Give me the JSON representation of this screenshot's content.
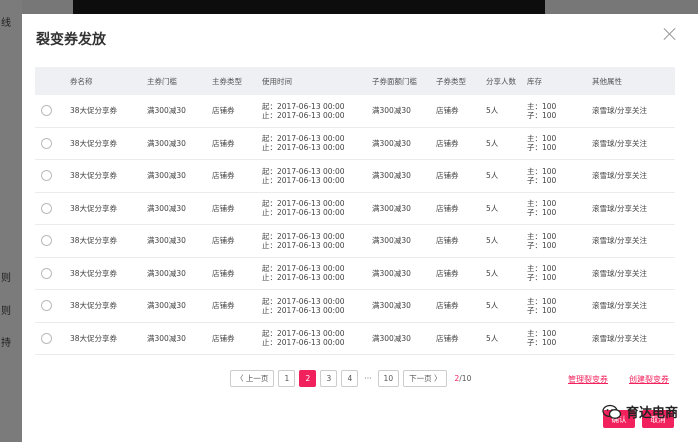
{
  "background": {
    "side_chars": [
      "线",
      "则",
      "则",
      "持"
    ]
  },
  "modal": {
    "title": "裂变券发放"
  },
  "table": {
    "headers": [
      "券名称",
      "主券门槛",
      "主券类型",
      "使用时间",
      "子券面额门槛",
      "子券类型",
      "分享人数",
      "库存",
      "其他属性"
    ],
    "rows": [
      {
        "name": "38大促分享券",
        "threshold": "满300减30",
        "type": "店铺券",
        "start": "起：2017-06-13 00:00",
        "end": "止：2017-06-13 00:00",
        "sub_threshold": "满300减30",
        "sub_type": "店铺券",
        "share": "5人",
        "stock_main": "主：100",
        "stock_sub": "子：100",
        "attr": "滚雪球/分享关注"
      },
      {
        "name": "38大促分享券",
        "threshold": "满300减30",
        "type": "店铺券",
        "start": "起：2017-06-13 00:00",
        "end": "止：2017-06-13 00:00",
        "sub_threshold": "满300减30",
        "sub_type": "店铺券",
        "share": "5人",
        "stock_main": "主：100",
        "stock_sub": "子：100",
        "attr": "滚雪球/分享关注"
      },
      {
        "name": "38大促分享券",
        "threshold": "满300减30",
        "type": "店铺券",
        "start": "起：2017-06-13 00:00",
        "end": "止：2017-06-13 00:00",
        "sub_threshold": "满300减30",
        "sub_type": "店铺券",
        "share": "5人",
        "stock_main": "主：100",
        "stock_sub": "子：100",
        "attr": "滚雪球/分享关注"
      },
      {
        "name": "38大促分享券",
        "threshold": "满300减30",
        "type": "店铺券",
        "start": "起：2017-06-13 00:00",
        "end": "止：2017-06-13 00:00",
        "sub_threshold": "满300减30",
        "sub_type": "店铺券",
        "share": "5人",
        "stock_main": "主：100",
        "stock_sub": "子：100",
        "attr": "滚雪球/分享关注"
      },
      {
        "name": "38大促分享券",
        "threshold": "满300减30",
        "type": "店铺券",
        "start": "起：2017-06-13 00:00",
        "end": "止：2017-06-13 00:00",
        "sub_threshold": "满300减30",
        "sub_type": "店铺券",
        "share": "5人",
        "stock_main": "主：100",
        "stock_sub": "子：100",
        "attr": "滚雪球/分享关注"
      },
      {
        "name": "38大促分享券",
        "threshold": "满300减30",
        "type": "店铺券",
        "start": "起：2017-06-13 00:00",
        "end": "止：2017-06-13 00:00",
        "sub_threshold": "满300减30",
        "sub_type": "店铺券",
        "share": "5人",
        "stock_main": "主：100",
        "stock_sub": "子：100",
        "attr": "滚雪球/分享关注"
      },
      {
        "name": "38大促分享券",
        "threshold": "满300减30",
        "type": "店铺券",
        "start": "起：2017-06-13 00:00",
        "end": "止：2017-06-13 00:00",
        "sub_threshold": "满300减30",
        "sub_type": "店铺券",
        "share": "5人",
        "stock_main": "主：100",
        "stock_sub": "子：100",
        "attr": "滚雪球/分享关注"
      },
      {
        "name": "38大促分享券",
        "threshold": "满300减30",
        "type": "店铺券",
        "start": "起：2017-06-13 00:00",
        "end": "止：2017-06-13 00:00",
        "sub_threshold": "满300减30",
        "sub_type": "店铺券",
        "share": "5人",
        "stock_main": "主：100",
        "stock_sub": "子：100",
        "attr": "滚雪球/分享关注"
      }
    ]
  },
  "pagination": {
    "prev": "〈 上一页",
    "pages": [
      "1",
      "2",
      "3",
      "4"
    ],
    "active_page": "2",
    "ellipsis": "···",
    "last": "10",
    "next": "下一页 〉",
    "current": "2",
    "total": "/10"
  },
  "links": {
    "manage": "管理裂变券",
    "create": "创建裂变券"
  },
  "buttons": {
    "confirm": "确认",
    "cancel": "取消"
  },
  "watermark": {
    "text": "育达电商",
    "icon": "wechat-icon"
  },
  "colors": {
    "accent": "#f0215c",
    "header_bg": "#eef0f4"
  }
}
